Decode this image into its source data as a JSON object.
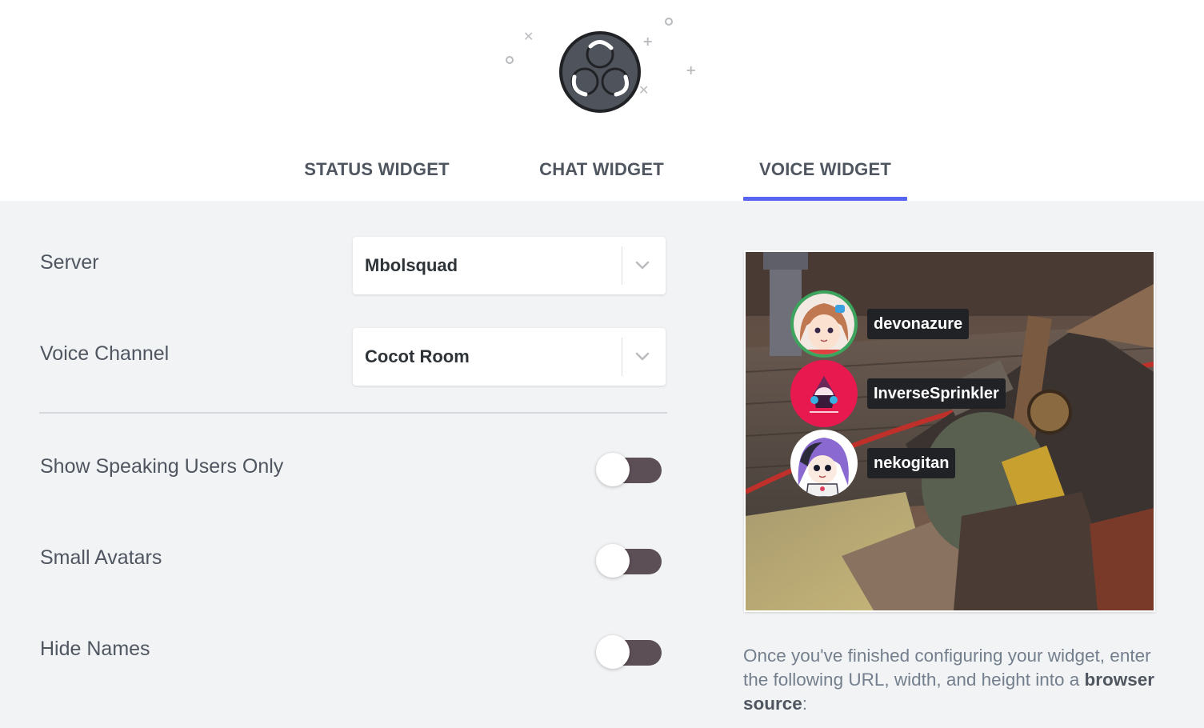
{
  "colors": {
    "accent": "#5865f2",
    "toggle_off_track": "#5c4f56",
    "header_bg": "#ffffff",
    "page_bg": "#f2f3f5",
    "name_tag_bg": "#202225",
    "speaking_ring": "#3ba55d"
  },
  "header": {
    "logo_icon": "obs-logo-icon",
    "tabs": [
      {
        "label": "STATUS WIDGET",
        "active": false
      },
      {
        "label": "CHAT WIDGET",
        "active": false
      },
      {
        "label": "VOICE WIDGET",
        "active": true
      }
    ]
  },
  "settings": {
    "server": {
      "label": "Server",
      "value": "Mbolsquad"
    },
    "voice_channel": {
      "label": "Voice Channel",
      "value": "Cocot Room"
    },
    "toggles": [
      {
        "label": "Show Speaking Users Only",
        "on": false
      },
      {
        "label": "Small Avatars",
        "on": false
      },
      {
        "label": "Hide Names",
        "on": false
      }
    ]
  },
  "preview": {
    "members": [
      {
        "name": "devonazure",
        "speaking": true
      },
      {
        "name": "InverseSprinkler",
        "speaking": false
      },
      {
        "name": "nekogitan",
        "speaking": false
      }
    ]
  },
  "help": {
    "text_before": "Once you've finished configuring your widget, enter the following URL, width, and height into a ",
    "bold": "browser source",
    "text_after": ":"
  }
}
